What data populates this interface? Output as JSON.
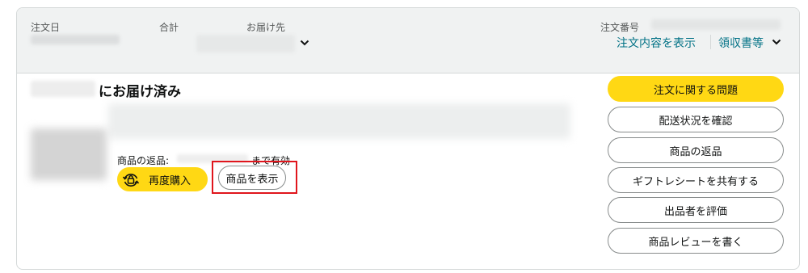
{
  "header": {
    "order_date_label": "注文日",
    "total_label": "合計",
    "ship_to_label": "お届け先",
    "order_number_label": "注文番号",
    "view_order_details": "注文内容を表示",
    "receipt_link": "領収書等"
  },
  "shipment": {
    "status_title": "にお届け済み",
    "return_label": "商品の返品:",
    "return_suffix": "まで有効"
  },
  "item_actions": {
    "buy_again": "再度購入",
    "view_item": "商品を表示"
  },
  "side_actions": [
    "注文に関する問題",
    "配送状況を確認",
    "商品の返品",
    "ギフトレシートを共有する",
    "出品者を評価",
    "商品レビューを書く"
  ],
  "colors": {
    "primary_button": "#ffd814",
    "link": "#007185",
    "highlight_box": "#e0151c"
  }
}
